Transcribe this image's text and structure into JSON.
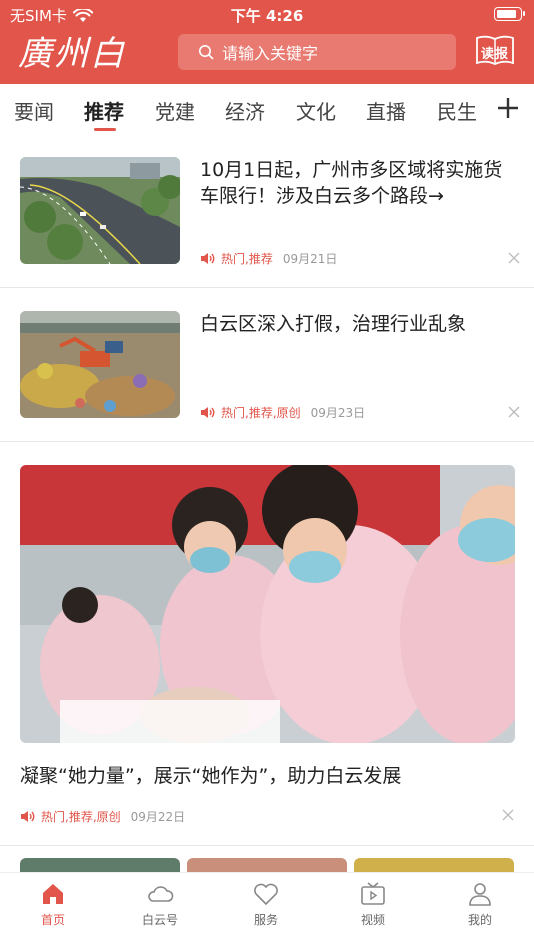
{
  "status_bar": {
    "carrier": "无SIM卡",
    "time": "下午 4:26",
    "battery_level": 0.85
  },
  "header": {
    "logo_text": "廣州白云",
    "search_placeholder": "请输入关键字",
    "read_label": "读报",
    "brand_color": "#e2554a"
  },
  "tabs": [
    {
      "label": "要闻",
      "active": false
    },
    {
      "label": "推荐",
      "active": true
    },
    {
      "label": "党建",
      "active": false
    },
    {
      "label": "经济",
      "active": false
    },
    {
      "label": "文化",
      "active": false
    },
    {
      "label": "直播",
      "active": false
    },
    {
      "label": "民生",
      "active": false
    }
  ],
  "news": [
    {
      "title": "10月1日起，广州市多区域将实施货车限行！涉及白云多个路段→",
      "tags": "热门,推荐",
      "date": "09月21日",
      "thumb_icon": "highway-photo"
    },
    {
      "title": "白云区深入打假，治理行业乱象",
      "tags": "热门,推荐,原创",
      "date": "09月23日",
      "thumb_icon": "excavator-photo"
    },
    {
      "title": "凝聚“她力量”，展示“她作为”，助力白云发展",
      "tags": "热门,推荐,原创",
      "date": "09月22日",
      "thumb_icon": "nurses-training-photo"
    }
  ],
  "bottom_nav": [
    {
      "label": "首页",
      "icon": "home-icon",
      "active": true
    },
    {
      "label": "白云号",
      "icon": "cloud-icon",
      "active": false
    },
    {
      "label": "服务",
      "icon": "heart-icon",
      "active": false
    },
    {
      "label": "视频",
      "icon": "tv-icon",
      "active": false
    },
    {
      "label": "我的",
      "icon": "user-icon",
      "active": false
    }
  ]
}
